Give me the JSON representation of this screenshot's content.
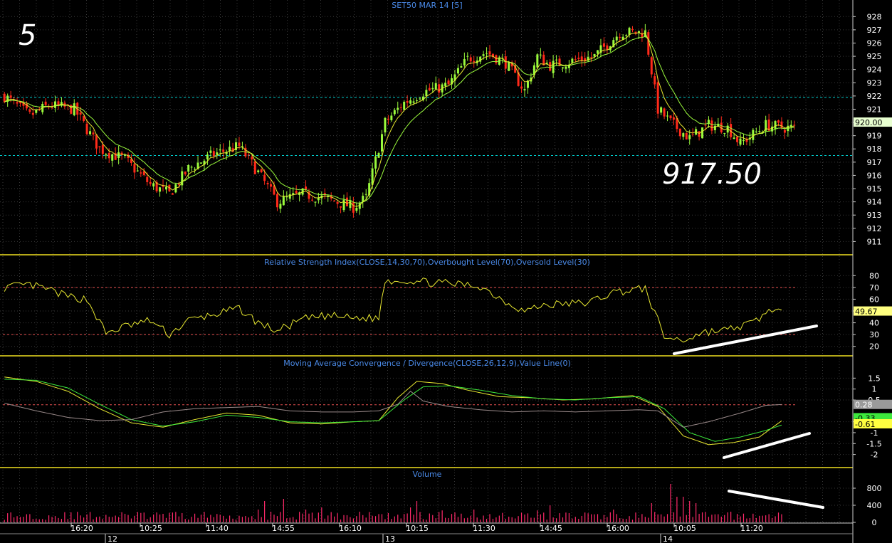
{
  "period_label": "5",
  "annotation_price": "917.50",
  "colors": {
    "up": "#9afa3c",
    "down": "#ff2a1a",
    "ma_fast": "#e8e830",
    "ma_slow": "#9afa3c",
    "rsi": "#e8e830",
    "macd": "#e8e830",
    "signal": "#3ce83c",
    "histo": "#9a8a8a",
    "volume": "#ff2a6a",
    "grid": "#3a3a3a",
    "divider": "#f0e020",
    "title": "#4a8ae8",
    "axis_text": "#ffffff",
    "ref_line": "#00c8c8",
    "level_line": "#e85050"
  },
  "chart_data": [
    {
      "type": "candlestick",
      "title": "SET50 MAR 14   [5]",
      "ylim": [
        910,
        928.5
      ],
      "yticks": [
        911,
        912,
        913,
        914,
        915,
        916,
        917,
        918,
        919,
        920,
        921,
        922,
        923,
        924,
        925,
        926,
        927,
        928
      ],
      "last_value": "920.00",
      "reference_lines": [
        921.9,
        917.5
      ],
      "segments": [
        [
          0,
          922
        ],
        [
          8,
          920.5
        ],
        [
          14,
          921.3
        ],
        [
          22,
          921
        ],
        [
          30,
          918
        ],
        [
          38,
          917.2
        ],
        [
          46,
          915.3
        ],
        [
          52,
          914.6
        ],
        [
          58,
          916.5
        ],
        [
          66,
          917.6
        ],
        [
          74,
          918.2
        ],
        [
          80,
          916.2
        ],
        [
          86,
          914
        ],
        [
          94,
          914.6
        ],
        [
          102,
          914.2
        ],
        [
          110,
          913.6
        ],
        [
          114,
          914.3
        ],
        [
          120,
          920
        ],
        [
          126,
          921.5
        ],
        [
          132,
          922.3
        ],
        [
          140,
          922.8
        ],
        [
          146,
          924.8
        ],
        [
          152,
          925.3
        ],
        [
          158,
          924.5
        ],
        [
          164,
          922.4
        ],
        [
          168,
          925
        ],
        [
          172,
          924.3
        ],
        [
          178,
          924.6
        ],
        [
          186,
          925
        ],
        [
          194,
          926.8
        ],
        [
          202,
          926.8
        ],
        [
          206,
          921
        ],
        [
          210,
          920
        ],
        [
          216,
          918.8
        ],
        [
          222,
          919.8
        ],
        [
          228,
          919.6
        ],
        [
          232,
          918.4
        ],
        [
          240,
          919.8
        ],
        [
          246,
          919.6
        ]
      ],
      "x_tick_labels": [
        "16:20",
        "10:25",
        "11:40",
        "14:55",
        "16:10",
        "10:15",
        "11:30",
        "14:45",
        "16:00",
        "10:05",
        "11:20"
      ],
      "date_labels": [
        "12",
        "13",
        "14"
      ]
    },
    {
      "type": "line",
      "title": "Relative Strength Index(CLOSE,14,30,70),Overbought Level(70),Oversold Level(30)",
      "ylim": [
        12,
        88
      ],
      "yticks": [
        20,
        30,
        40,
        50,
        60,
        70,
        80
      ],
      "levels": [
        70,
        30
      ],
      "last_value": "49.67",
      "series": [
        {
          "name": "RSI",
          "segments": [
            [
              0,
              70
            ],
            [
              8,
              72
            ],
            [
              14,
              68
            ],
            [
              20,
              62
            ],
            [
              26,
              60
            ],
            [
              32,
              31
            ],
            [
              38,
              37
            ],
            [
              46,
              42
            ],
            [
              52,
              30
            ],
            [
              58,
              42
            ],
            [
              66,
              47
            ],
            [
              74,
              52
            ],
            [
              80,
              40
            ],
            [
              86,
              33
            ],
            [
              94,
              43
            ],
            [
              102,
              46
            ],
            [
              110,
              44
            ],
            [
              118,
              44
            ],
            [
              120,
              76
            ],
            [
              126,
              76
            ],
            [
              136,
              74
            ],
            [
              146,
              72
            ],
            [
              150,
              71
            ],
            [
              158,
              58
            ],
            [
              164,
              50
            ],
            [
              170,
              55
            ],
            [
              176,
              56
            ],
            [
              184,
              57
            ],
            [
              192,
              66
            ],
            [
              202,
              69
            ],
            [
              208,
              28
            ],
            [
              214,
              25
            ],
            [
              220,
              32
            ],
            [
              228,
              34
            ],
            [
              236,
              40
            ],
            [
              242,
              52
            ],
            [
              246,
              48
            ]
          ]
        }
      ]
    },
    {
      "type": "line",
      "title": "Moving Average Convergence / Divergence(CLOSE,26,12,9),Value Line(0)",
      "ylim": [
        -2.6,
        2.0
      ],
      "yticks": [
        -2,
        -1.5,
        -1,
        -0.5,
        0.5,
        1,
        1.5
      ],
      "level": 0.28,
      "value_labels": [
        "0.28",
        "-0.33",
        "-0.61"
      ],
      "series": [
        {
          "name": "MACD",
          "segments": [
            [
              0,
              1.55
            ],
            [
              10,
              1.35
            ],
            [
              20,
              0.9
            ],
            [
              30,
              0.1
            ],
            [
              40,
              -0.55
            ],
            [
              50,
              -0.75
            ],
            [
              60,
              -0.4
            ],
            [
              70,
              -0.1
            ],
            [
              80,
              -0.2
            ],
            [
              90,
              -0.55
            ],
            [
              100,
              -0.6
            ],
            [
              110,
              -0.5
            ],
            [
              118,
              -0.45
            ],
            [
              124,
              0.6
            ],
            [
              130,
              1.35
            ],
            [
              138,
              1.25
            ],
            [
              146,
              0.95
            ],
            [
              156,
              0.65
            ],
            [
              166,
              0.6
            ],
            [
              176,
              0.5
            ],
            [
              186,
              0.55
            ],
            [
              198,
              0.7
            ],
            [
              206,
              0.2
            ],
            [
              214,
              -1.15
            ],
            [
              222,
              -1.55
            ],
            [
              230,
              -1.45
            ],
            [
              238,
              -1.2
            ],
            [
              246,
              -0.35
            ]
          ]
        },
        {
          "name": "Signal",
          "segments": [
            [
              0,
              1.45
            ],
            [
              10,
              1.4
            ],
            [
              20,
              1.05
            ],
            [
              30,
              0.3
            ],
            [
              40,
              -0.4
            ],
            [
              50,
              -0.7
            ],
            [
              60,
              -0.5
            ],
            [
              70,
              -0.2
            ],
            [
              80,
              -0.3
            ],
            [
              90,
              -0.5
            ],
            [
              100,
              -0.55
            ],
            [
              110,
              -0.5
            ],
            [
              118,
              -0.45
            ],
            [
              126,
              0.5
            ],
            [
              132,
              1.1
            ],
            [
              140,
              1.15
            ],
            [
              150,
              0.95
            ],
            [
              160,
              0.7
            ],
            [
              170,
              0.55
            ],
            [
              180,
              0.5
            ],
            [
              190,
              0.6
            ],
            [
              200,
              0.65
            ],
            [
              208,
              0.1
            ],
            [
              216,
              -1.0
            ],
            [
              224,
              -1.4
            ],
            [
              232,
              -1.2
            ],
            [
              240,
              -0.9
            ],
            [
              246,
              -0.6
            ]
          ]
        },
        {
          "name": "Divergence",
          "segments": [
            [
              0,
              0.35
            ],
            [
              10,
              0.0
            ],
            [
              20,
              -0.3
            ],
            [
              30,
              -0.45
            ],
            [
              40,
              -0.4
            ],
            [
              50,
              -0.05
            ],
            [
              60,
              0.1
            ],
            [
              70,
              0.15
            ],
            [
              80,
              0.2
            ],
            [
              90,
              0.0
            ],
            [
              100,
              -0.05
            ],
            [
              110,
              -0.05
            ],
            [
              118,
              0.0
            ],
            [
              124,
              0.3
            ],
            [
              128,
              0.9
            ],
            [
              132,
              0.45
            ],
            [
              140,
              0.2
            ],
            [
              150,
              0.05
            ],
            [
              160,
              -0.05
            ],
            [
              170,
              0.0
            ],
            [
              180,
              -0.05
            ],
            [
              190,
              0.0
            ],
            [
              200,
              0.05
            ],
            [
              206,
              0.0
            ],
            [
              214,
              -0.75
            ],
            [
              222,
              -0.5
            ],
            [
              232,
              -0.1
            ],
            [
              240,
              0.25
            ],
            [
              246,
              0.3
            ]
          ]
        }
      ]
    },
    {
      "type": "bar",
      "title": "Volume",
      "ylim": [
        0,
        1000
      ],
      "yticks": [
        0,
        400,
        800
      ],
      "spikes": [
        [
          50,
          200
        ],
        [
          80,
          300
        ],
        [
          82,
          500
        ],
        [
          84,
          250
        ],
        [
          88,
          550
        ],
        [
          95,
          300
        ],
        [
          100,
          350
        ],
        [
          112,
          250
        ],
        [
          128,
          350
        ],
        [
          130,
          500
        ],
        [
          138,
          280
        ],
        [
          148,
          300
        ],
        [
          168,
          280
        ],
        [
          172,
          400
        ],
        [
          192,
          300
        ],
        [
          204,
          450
        ],
        [
          210,
          900
        ],
        [
          212,
          600
        ],
        [
          214,
          600
        ],
        [
          216,
          500
        ],
        [
          218,
          450
        ]
      ]
    }
  ]
}
